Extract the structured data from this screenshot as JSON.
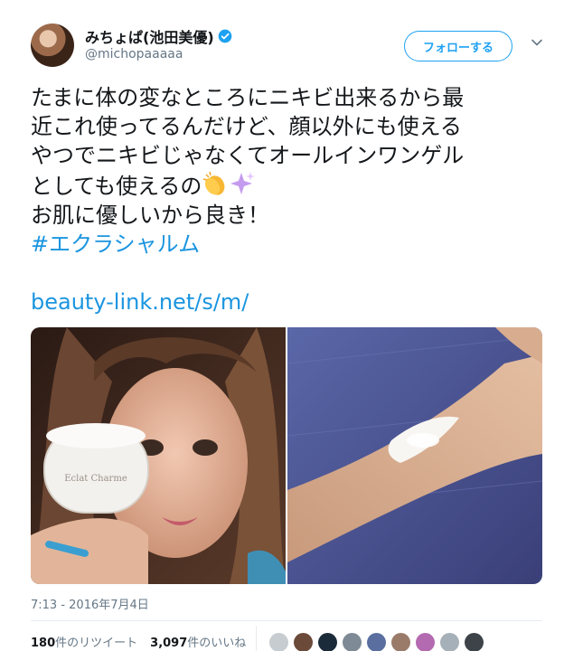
{
  "author": {
    "display_name": "みちょぱ(池田美優)",
    "handle": "@michopaaaaa",
    "verified": true,
    "avatar_icon": "user-avatar"
  },
  "follow_button": {
    "label": "フォローする"
  },
  "menu_icon": "chevron-down-icon",
  "tweet": {
    "lines": [
      "たまに体の変なところにニキビ出来るから最",
      "近これ使ってるんだけど、顔以外にも使える",
      "やつでニキビじゃなくてオールインワンゲル",
      "としても使えるの",
      "お肌に優しいから良き！"
    ],
    "emojis": [
      "clapping-hands-emoji",
      "sparkles-emoji"
    ],
    "hashtag": "#エクラシャルム",
    "link": "beauty-link.net/s/m/"
  },
  "media": {
    "left_photo": "selfie-with-cream-jar",
    "right_photo": "cream-on-arm",
    "jar_label": "Eclat Charme"
  },
  "timestamp": "7:13 - 2016年7月4日",
  "stats": {
    "retweets_count": "180",
    "retweets_label": "件のリツイート",
    "likes_count": "3,097",
    "likes_label": "件のいいね"
  },
  "colors": {
    "accent": "#1da1f2",
    "link": "#1b95e0",
    "text": "#14171a",
    "muted": "#657786"
  }
}
